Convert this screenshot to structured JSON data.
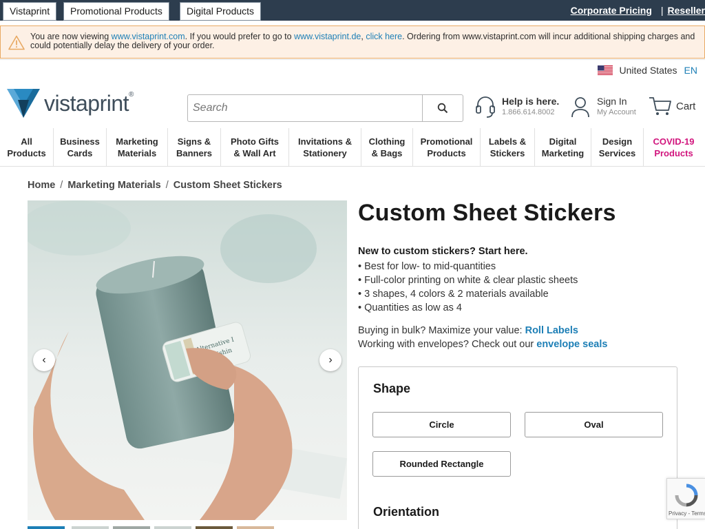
{
  "topbar": {
    "tabs": [
      "Vistaprint",
      "Promotional Products",
      "Digital Products"
    ],
    "corporate_pricing": "Corporate Pricing",
    "separator": "|",
    "reseller": "Reseller"
  },
  "alert": {
    "text_1": "You are now viewing ",
    "link_1": "www.vistaprint.com",
    "text_2": ". If you would prefer to go to ",
    "link_2": "www.vistaprint.de",
    "text_3": ", ",
    "link_3": "click here",
    "text_4": ". Ordering from www.vistaprint.com will incur additional shipping charges and could potentially delay the delivery of your order."
  },
  "locale": {
    "country": "United States",
    "language": "EN"
  },
  "header": {
    "logo_text": "vistaprint",
    "logo_mark": "®",
    "search_placeholder": "Search",
    "help_title": "Help is here.",
    "help_phone": "1.866.614.8002",
    "signin_title": "Sign In",
    "signin_sub": "My Account",
    "cart_label": "Cart"
  },
  "nav": [
    {
      "l1": "All",
      "l2": "Products"
    },
    {
      "l1": "Business",
      "l2": "Cards"
    },
    {
      "l1": "Marketing",
      "l2": "Materials"
    },
    {
      "l1": "Signs &",
      "l2": "Banners"
    },
    {
      "l1": "Photo Gifts",
      "l2": "& Wall Art"
    },
    {
      "l1": "Invitations &",
      "l2": "Stationery"
    },
    {
      "l1": "Clothing",
      "l2": "& Bags"
    },
    {
      "l1": "Promotional",
      "l2": "Products"
    },
    {
      "l1": "Labels &",
      "l2": "Stickers"
    },
    {
      "l1": "Digital",
      "l2": "Marketing"
    },
    {
      "l1": "Design",
      "l2": "Services"
    },
    {
      "l1": "COVID-19",
      "l2": "Products"
    }
  ],
  "breadcrumb": [
    "Home",
    "Marketing Materials",
    "Custom Sheet Stickers"
  ],
  "breadcrumb_sep": "/",
  "gallery": {
    "prev": "‹",
    "next": "›",
    "label_line1": "Alternative I",
    "label_line2": "Furnishin"
  },
  "product": {
    "title": "Custom Sheet Stickers",
    "lead": "New to custom stickers? Start here.",
    "bullets": [
      "Best for low- to mid-quantities",
      "Full-color printing on white & clear plastic sheets",
      "3 shapes, 4 colors & 2 materials available",
      "Quantities as low as 4"
    ],
    "promo_1_text": "Buying in bulk? Maximize your value: ",
    "promo_1_link": "Roll Labels",
    "promo_2_text": "Working with envelopes? Check out our ",
    "promo_2_link": "envelope seals"
  },
  "options": {
    "shape_heading": "Shape",
    "shapes": [
      "Circle",
      "Oval",
      "Rounded Rectangle"
    ],
    "orientation_heading": "Orientation"
  },
  "recaptcha": {
    "terms": "Privacy - Terms"
  },
  "colors": {
    "topbar": "#2d3d4e",
    "link": "#1d7fb6",
    "covid": "#d1157d",
    "alert_bg": "#fdf0e5"
  }
}
